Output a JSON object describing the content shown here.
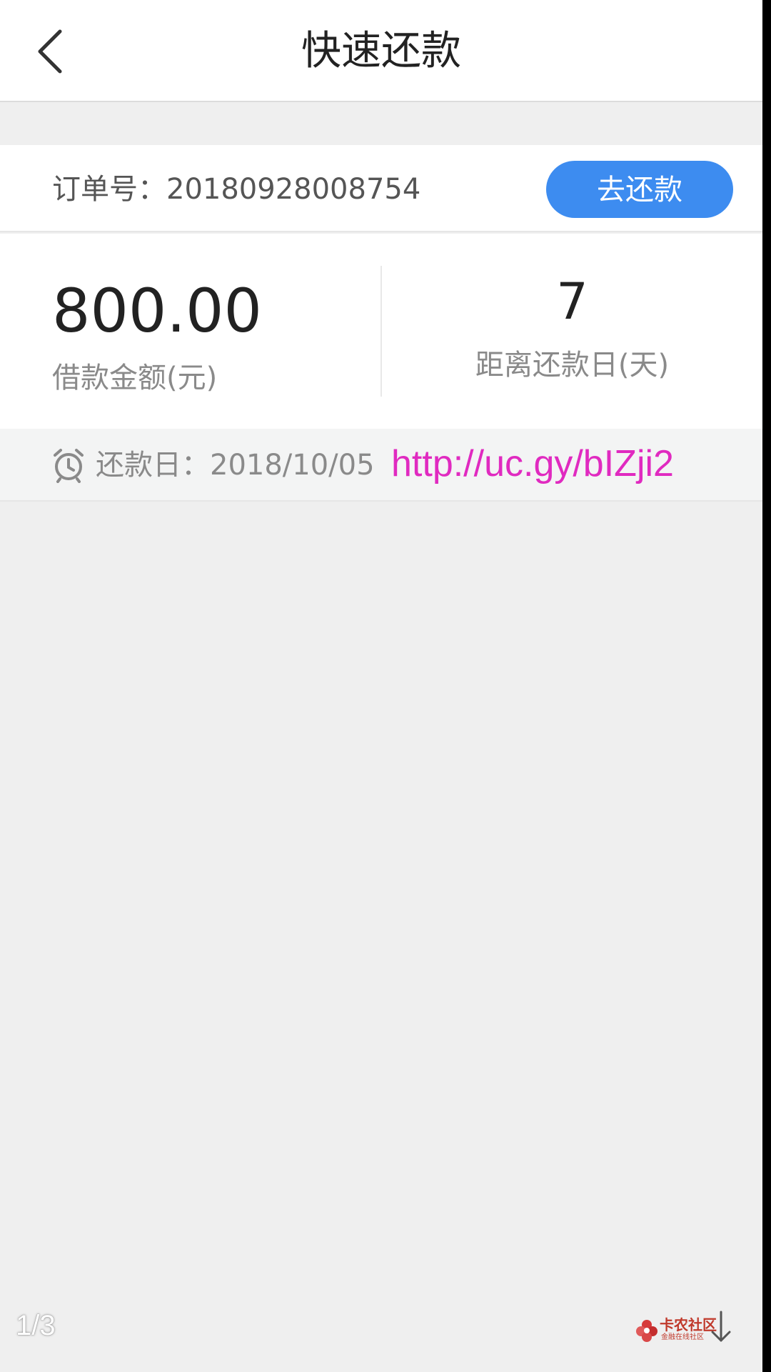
{
  "header": {
    "title": "快速还款",
    "back_icon": "chevron-left-icon"
  },
  "order": {
    "label": "订单号：",
    "number": "20180928008754",
    "button_label": "去还款",
    "button_color": "#3d8cf0"
  },
  "loan": {
    "amount": "800.00",
    "amount_label": "借款金额(元)",
    "days": "7",
    "days_label": "距离还款日(天)"
  },
  "due": {
    "icon": "alarm-clock-icon",
    "label": "还款日：",
    "date": "2018/10/05"
  },
  "overlay": {
    "link_text": "http://uc.gy/bIZji2",
    "link_color": "#e02ac0",
    "page_indicator": "1/3",
    "brand_name": "卡农社区",
    "brand_sub": "金融在线社区",
    "download_icon": "download-arrow-icon"
  }
}
